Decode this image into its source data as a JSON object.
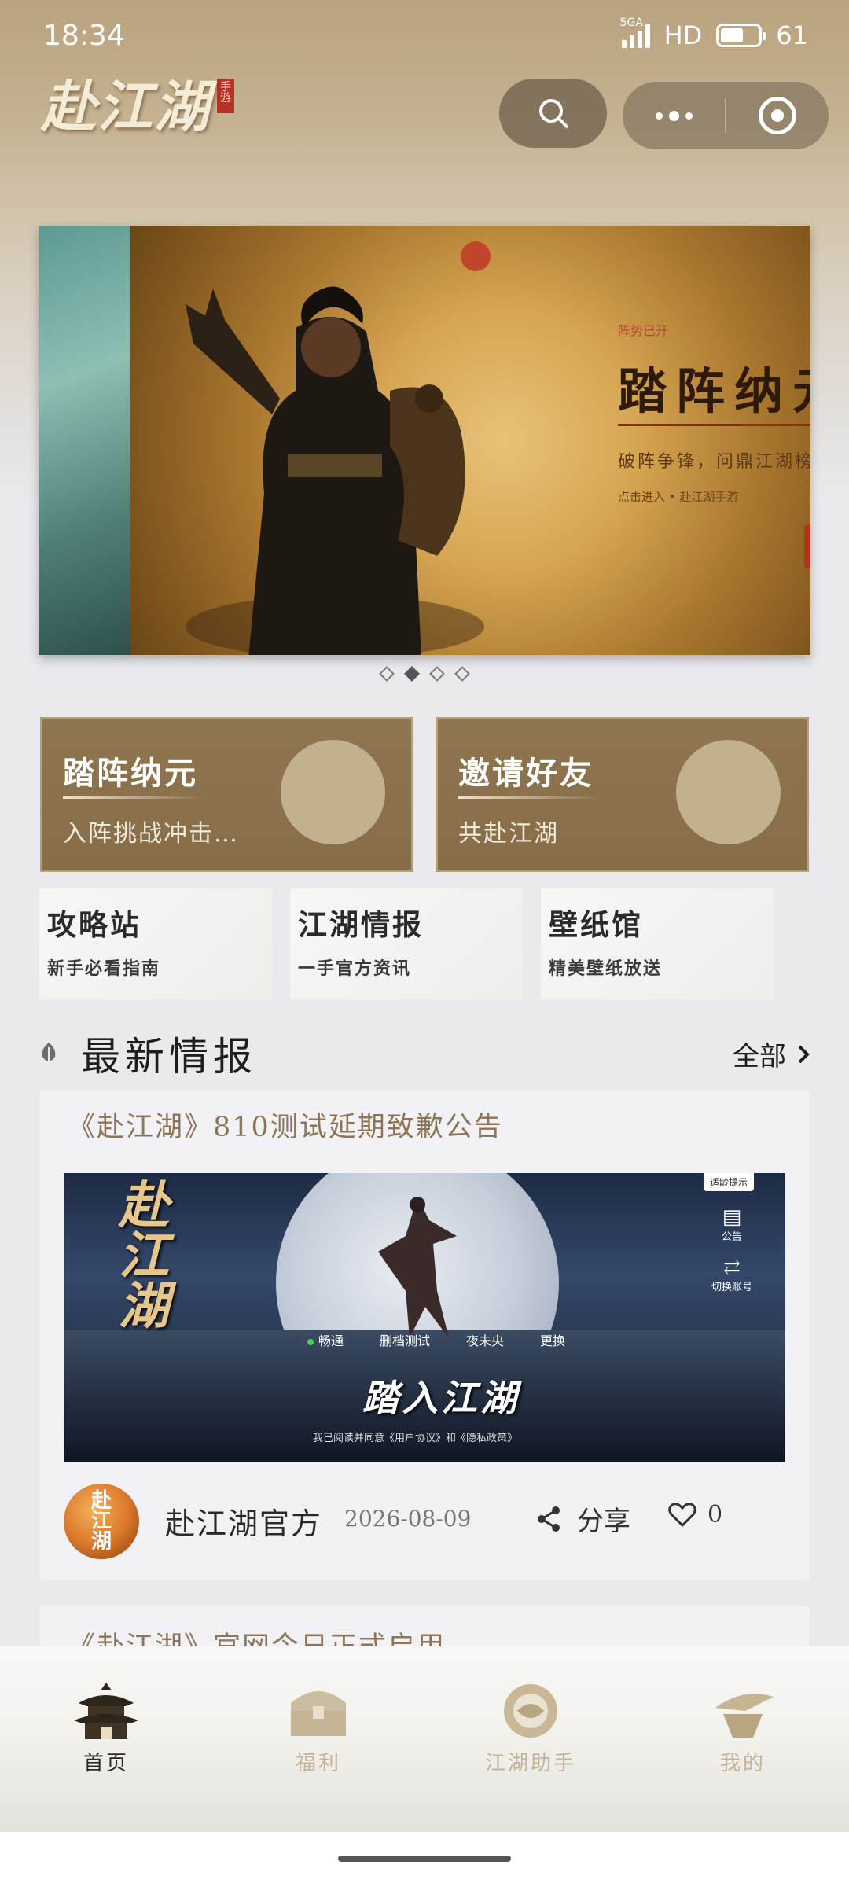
{
  "status_bar": {
    "time": "18:34",
    "network": "5GA",
    "hd": "HD",
    "battery": "61"
  },
  "header": {
    "logo_text": "赴江湖",
    "logo_seal": "手游",
    "search_icon": "search-icon",
    "more_icon": "more-dots-icon",
    "close_icon": "target-icon"
  },
  "banner": {
    "kicker": "阵势已开",
    "title": "踏阵纳元",
    "subtitle": "破阵争锋，问鼎江湖榜首",
    "meta": "点击进入  •  赴江湖手游",
    "active_index": 1,
    "count": 4
  },
  "features": [
    {
      "title": "踏阵纳元",
      "subtitle": "入阵挑战冲击…"
    },
    {
      "title": "邀请好友",
      "subtitle": "共赴江湖"
    }
  ],
  "quick_links": [
    {
      "title": "攻略站",
      "subtitle": "新手必看指南"
    },
    {
      "title": "江湖情报",
      "subtitle": "一手官方资讯"
    },
    {
      "title": "壁纸馆",
      "subtitle": "精美壁纸放送"
    }
  ],
  "section": {
    "title": "最新情报",
    "all_label": "全部"
  },
  "news": [
    {
      "title": "《赴江湖》810测试延期致歉公告",
      "image": {
        "game_logo": "赴江湖",
        "age_tag": "适龄提示",
        "side_notice": "公告",
        "side_switch": "切换账号",
        "menu": [
          "畅通",
          "删档测试",
          "夜未央",
          "更换"
        ],
        "enter": "踏入江湖",
        "agree": "我已阅读并同意《用户协议》和《隐私政策》"
      },
      "author": "赴江湖官方",
      "avatar_text": "赴江湖",
      "date": "2026-08-09",
      "share_label": "分享",
      "likes": "0"
    },
    {
      "title": "《赴江湖》官网今日正式启用"
    }
  ],
  "tabbar": [
    {
      "label": "首页",
      "icon": "pagoda-icon",
      "active": true
    },
    {
      "label": "福利",
      "icon": "treasure-chest-icon",
      "active": false
    },
    {
      "label": "江湖助手",
      "icon": "assistant-icon",
      "active": false
    },
    {
      "label": "我的",
      "icon": "hat-icon",
      "active": false
    }
  ],
  "colors": {
    "accent_brown": "#8f7650",
    "gold_text": "#8e7555",
    "tab_inactive": "#c2b397"
  }
}
